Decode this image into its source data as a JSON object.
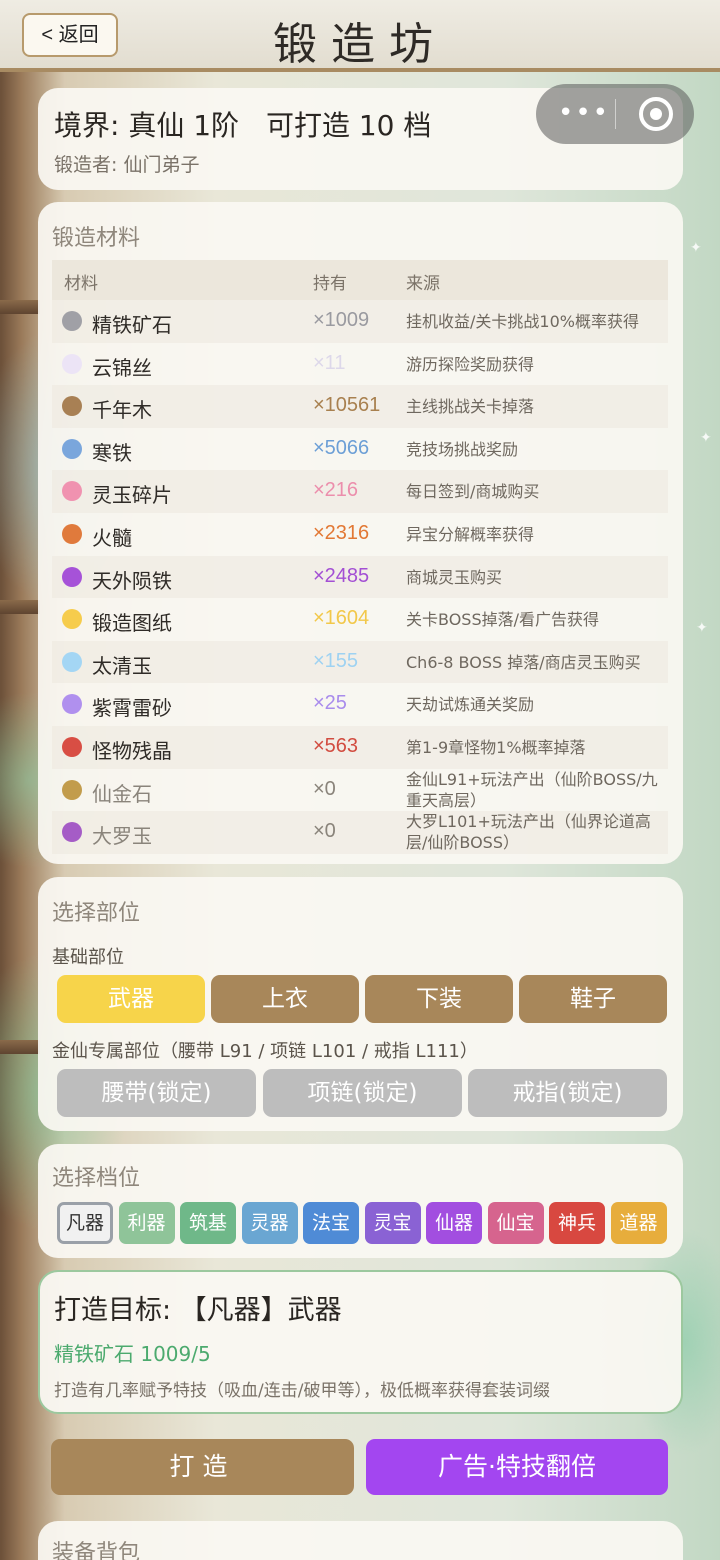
{
  "header": {
    "back_label": "< 返回",
    "title": "锻造坊"
  },
  "realm": {
    "realm_text": "境界: 真仙 1阶",
    "forgeable_text": "可打造 10 档",
    "forger_text": "锻造者: 仙门弟子"
  },
  "materials": {
    "title": "锻造材料",
    "columns": [
      "材料",
      "持有",
      "来源"
    ],
    "rows": [
      {
        "name": "精铁矿石",
        "qty": "×1009",
        "source": "挂机收益/关卡挑战10%概率获得",
        "dot": "#a0a0a6",
        "qty_color": "#9a9aa0",
        "dim": false
      },
      {
        "name": "云锦丝",
        "qty": "×11",
        "source": "游历探险奖励获得",
        "dot": "#ece4f6",
        "qty_color": "#ddd8ea",
        "dim": false
      },
      {
        "name": "千年木",
        "qty": "×10561",
        "source": "主线挑战关卡掉落",
        "dot": "#a88054",
        "qty_color": "#a8804f",
        "dim": false
      },
      {
        "name": "寒铁",
        "qty": "×5066",
        "source": "竞技场挑战奖励",
        "dot": "#7aa6dc",
        "qty_color": "#6c9fd6",
        "dim": false
      },
      {
        "name": "灵玉碎片",
        "qty": "×216",
        "source": "每日签到/商城购买",
        "dot": "#f092b0",
        "qty_color": "#ec8eac",
        "dim": false
      },
      {
        "name": "火髓",
        "qty": "×2316",
        "source": "异宝分解概率获得",
        "dot": "#e07a3c",
        "qty_color": "#e27834",
        "dim": false
      },
      {
        "name": "天外陨铁",
        "qty": "×2485",
        "source": "商城灵玉购买",
        "dot": "#a652d8",
        "qty_color": "#a34fd4",
        "dim": false
      },
      {
        "name": "锻造图纸",
        "qty": "×1604",
        "source": "关卡BOSS掉落/看广告获得",
        "dot": "#f6cc4c",
        "qty_color": "#f2c84a",
        "dim": false
      },
      {
        "name": "太清玉",
        "qty": "×155",
        "source": "Ch6-8 BOSS 掉落/商店灵玉购买",
        "dot": "#a4d6f4",
        "qty_color": "#9ed2f2",
        "dim": false
      },
      {
        "name": "紫霄雷砂",
        "qty": "×25",
        "source": "天劫试炼通关奖励",
        "dot": "#b090ee",
        "qty_color": "#a98cec",
        "dim": false
      },
      {
        "name": "怪物残晶",
        "qty": "×563",
        "source": "第1-9章怪物1%概率掉落",
        "dot": "#d84e44",
        "qty_color": "#d24c40",
        "dim": false
      },
      {
        "name": "仙金石",
        "qty": "×0",
        "source": "金仙L91+玩法产出（仙阶BOSS/九重天高层）",
        "dot": "#c29c4c",
        "qty_color": "#8a847b",
        "dim": true
      },
      {
        "name": "大罗玉",
        "qty": "×0",
        "source": "大罗L101+玩法产出（仙界论道高层/仙阶BOSS）",
        "dot": "#a55cc6",
        "qty_color": "#8a847b",
        "dim": true
      }
    ]
  },
  "parts": {
    "title": "选择部位",
    "basic_label": "基础部位",
    "basic": [
      {
        "label": "武器",
        "active": true
      },
      {
        "label": "上衣",
        "active": false
      },
      {
        "label": "下装",
        "active": false
      },
      {
        "label": "鞋子",
        "active": false
      }
    ],
    "exclusive_label": "金仙专属部位（腰带 L91 / 项链 L101 / 戒指 L111）",
    "locked": [
      "腰带(锁定)",
      "项链(锁定)",
      "戒指(锁定)"
    ]
  },
  "tiers": {
    "title": "选择档位",
    "items": [
      {
        "label": "凡器",
        "color": "#f1f1f1",
        "selected": true
      },
      {
        "label": "利器",
        "color": "#8fc499",
        "selected": false
      },
      {
        "label": "筑基",
        "color": "#6fb889",
        "selected": false
      },
      {
        "label": "灵器",
        "color": "#6aa6d2",
        "selected": false
      },
      {
        "label": "法宝",
        "color": "#4f8bd6",
        "selected": false
      },
      {
        "label": "灵宝",
        "color": "#8a62d4",
        "selected": false
      },
      {
        "label": "仙器",
        "color": "#a24ee0",
        "selected": false
      },
      {
        "label": "仙宝",
        "color": "#d6648e",
        "selected": false
      },
      {
        "label": "神兵",
        "color": "#d84840",
        "selected": false
      },
      {
        "label": "道器",
        "color": "#e7ad3c",
        "selected": false
      }
    ]
  },
  "target": {
    "title": "打造目标: 【凡器】武器",
    "requirement": "精铁矿石 1009/5",
    "note": "打造有几率赋予特技（吸血/连击/破甲等），极低概率获得套装词缀"
  },
  "actions": {
    "forge_label": "打造",
    "ad_label": "广告·特技翻倍"
  },
  "bag": {
    "title": "装备背包"
  }
}
